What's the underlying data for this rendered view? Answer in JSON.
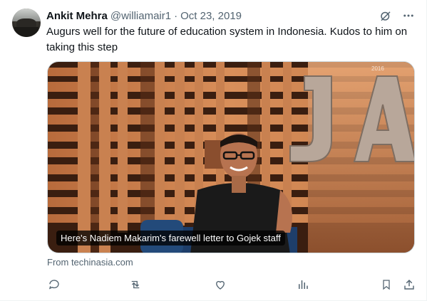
{
  "author": {
    "name": "Ankit Mehra",
    "handle": "@williamair1",
    "separator": "·",
    "date": "Oct 23, 2019"
  },
  "tweet": {
    "text": "Augurs well for the future of education system in Indonesia. Kudos to him on taking this step"
  },
  "card": {
    "image_caption": "Here's Nadiem Makarim's farewell letter to Gojek staff",
    "source": "From techinasia.com",
    "year_mark": "2016"
  },
  "icons": {
    "header": [
      "grok-icon",
      "more-icon"
    ],
    "actions": [
      "reply-icon",
      "retweet-icon",
      "like-icon",
      "views-icon",
      "bookmark-icon",
      "share-icon"
    ]
  },
  "colors": {
    "text_primary": "#0f1419",
    "text_secondary": "#536471",
    "border": "#cfd9de"
  }
}
